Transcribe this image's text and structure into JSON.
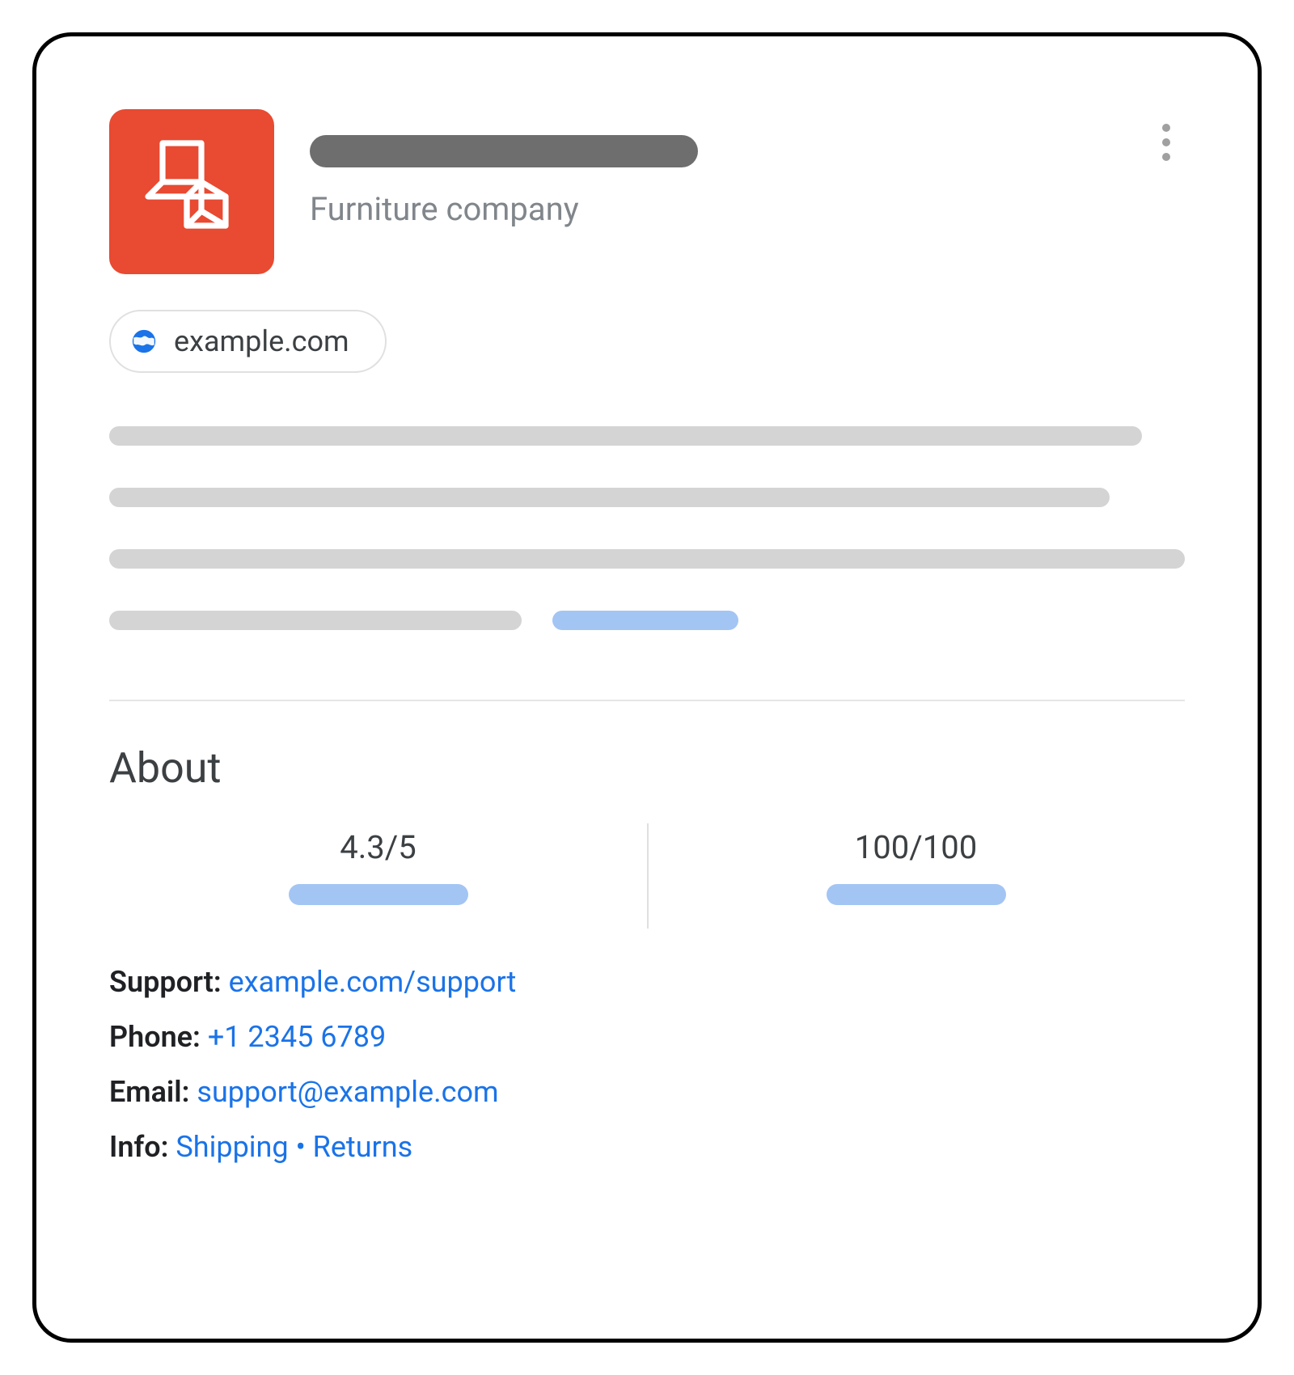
{
  "header": {
    "category": "Furniture company"
  },
  "website": {
    "domain": "example.com"
  },
  "about": {
    "heading": "About",
    "rating_left": "4.3/5",
    "rating_right": "100/100"
  },
  "contact": {
    "support_label": "Support:",
    "support_link": "example.com/support",
    "phone_label": "Phone:",
    "phone_link": "+1 2345 6789",
    "email_label": "Email:",
    "email_link": "support@example.com",
    "info_label": "Info:",
    "info_shipping": "Shipping",
    "info_sep": "•",
    "info_returns": "Returns"
  }
}
